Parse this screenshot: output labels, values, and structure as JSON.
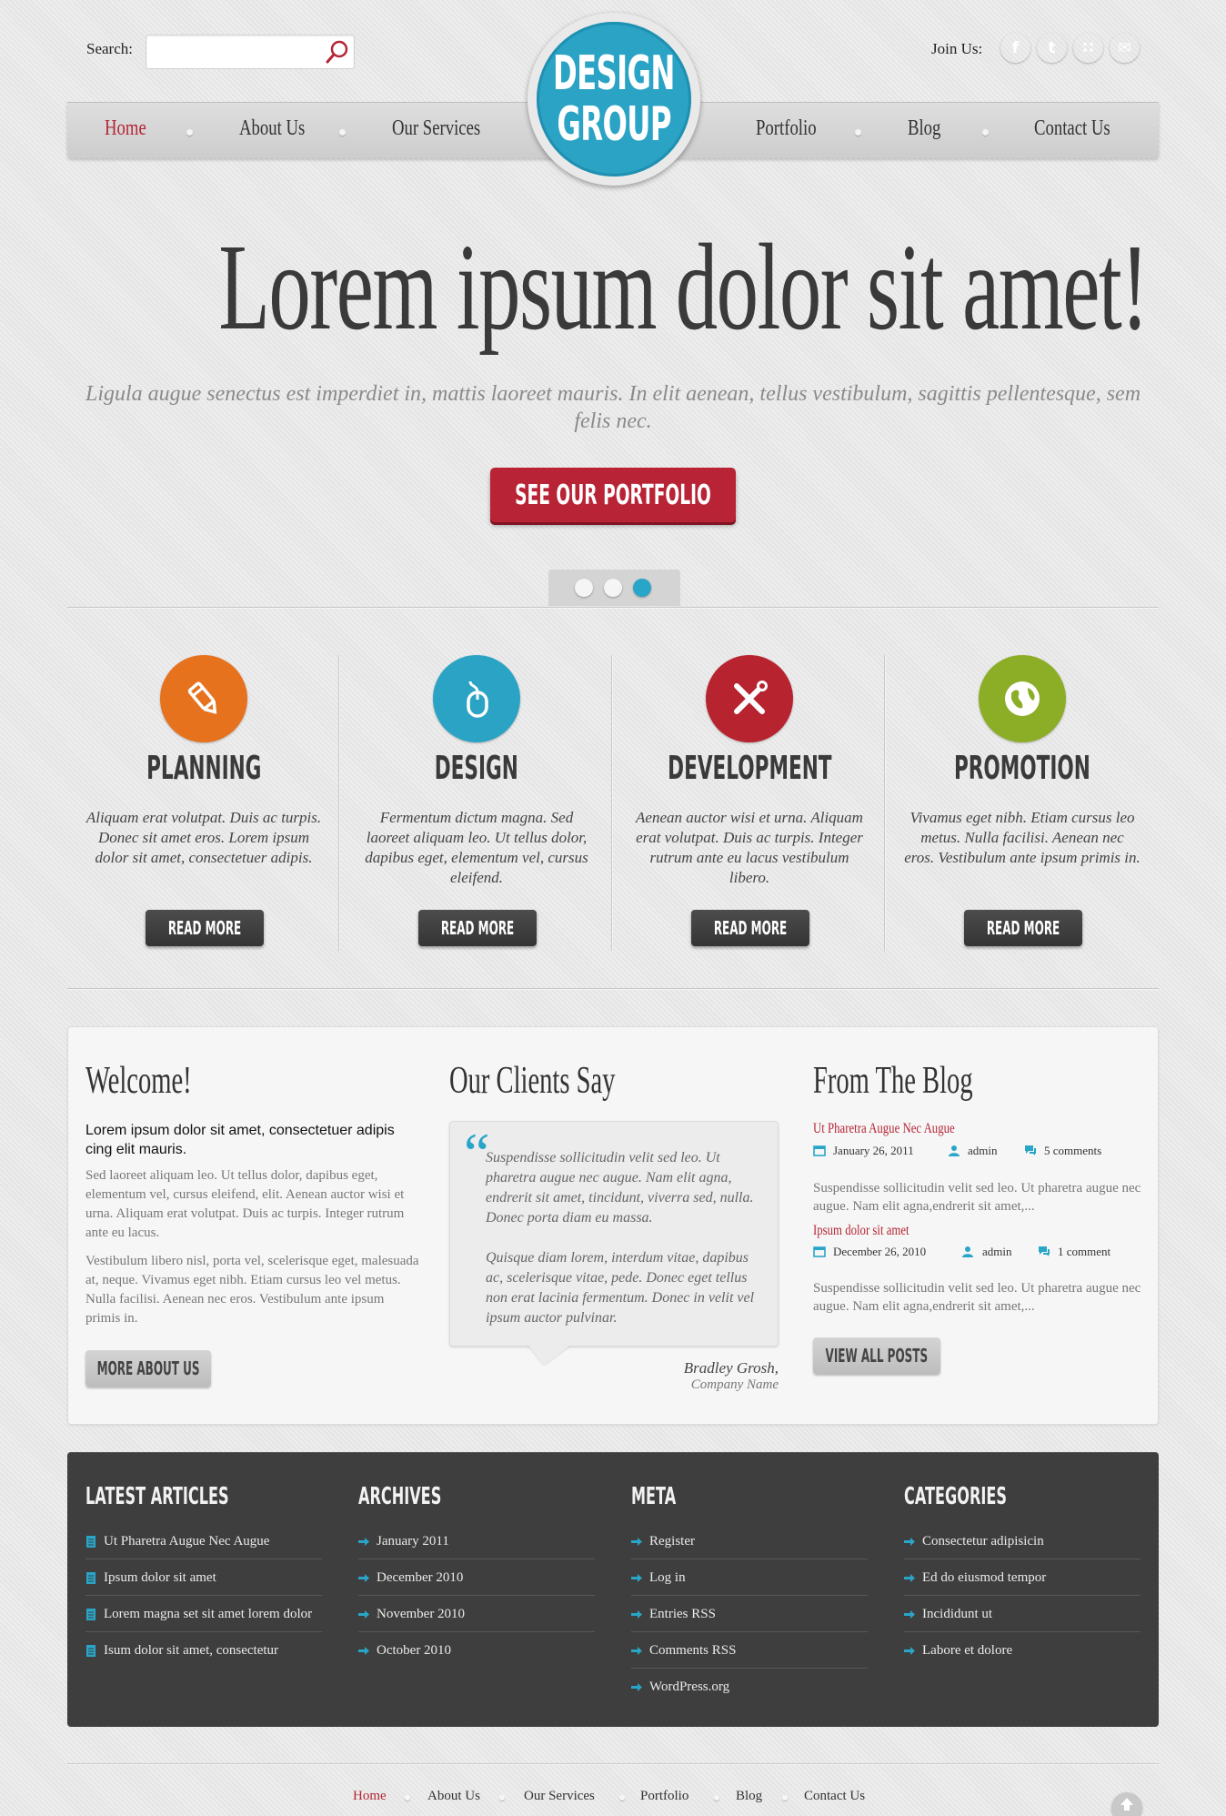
{
  "header": {
    "search_label": "Search:",
    "search_placeholder": "",
    "join_label": "Join Us:",
    "social": [
      {
        "name": "facebook",
        "glyph": "f",
        "color": "#3a5a98"
      },
      {
        "name": "twitter",
        "glyph": "t",
        "color": "#2aa4dd"
      },
      {
        "name": "rss",
        "glyph": "∷",
        "color": "#f1951f"
      },
      {
        "name": "email",
        "glyph": "✉",
        "color": "#a7a7a7"
      }
    ],
    "logo": {
      "line1": "DESIGN",
      "line2": "GROUP"
    }
  },
  "nav": {
    "items": [
      "Home",
      "About Us",
      "Our Services",
      "Portfolio",
      "Blog",
      "Contact Us"
    ],
    "active": "Home"
  },
  "hero": {
    "title": "Lorem ipsum dolor sit amet!",
    "subtitle": "Ligula augue senectus est imperdiet in, mattis laoreet mauris. In elit aenean, tellus vestibulum, sagittis pellentesque, sem felis nec.",
    "cta_label": "SEE OUR PORTFOLIO",
    "slides_total": 3,
    "slide_active": 3
  },
  "features": [
    {
      "title": "PLANNING",
      "icon": "pencil-icon",
      "color": "#e6721d",
      "text": "Aliquam erat volutpat. Duis ac turpis. Donec sit amet eros. Lorem ipsum dolor sit amet, consectetuer adipis.",
      "button": "READ MORE"
    },
    {
      "title": "DESIGN",
      "icon": "mouse-icon",
      "color": "#2ba3c5",
      "text": "Fermentum dictum magna. Sed laoreet aliquam leo. Ut tellus dolor, dapibus eget, elementum vel, cursus eleifend.",
      "button": "READ MORE"
    },
    {
      "title": "DEVELOPMENT",
      "icon": "tools-icon",
      "color": "#b7232f",
      "text": "Aenean auctor wisi et urna. Aliquam erat volutpat. Duis ac turpis. Integer rutrum ante eu lacus vestibulum libero.",
      "button": "READ MORE"
    },
    {
      "title": "PROMOTION",
      "icon": "globe-icon",
      "color": "#8cae26",
      "text": "Vivamus eget nibh. Etiam cursus leo metus. Nulla facilisi. Aenean nec eros. Vestibulum ante ipsum primis in.",
      "button": "READ MORE"
    }
  ],
  "welcome": {
    "title": "Welcome!",
    "lead": "Lorem ipsum dolor sit amet, consectetuer adipis cing elit mauris.",
    "p1": "Sed laoreet aliquam leo. Ut tellus dolor, dapibus eget, elementum vel, cursus eleifend, elit. Aenean auctor wisi et urna. Aliquam erat volutpat. Duis ac turpis. Integer rutrum ante eu lacus.",
    "p2": "Vestibulum libero nisl, porta vel, scelerisque eget, malesuada at, neque. Vivamus eget nibh. Etiam cursus leo vel metus. Nulla facilisi. Aenean nec eros. Vestibulum ante ipsum primis in.",
    "button": "MORE ABOUT US"
  },
  "testimonial": {
    "title": "Our Clients Say",
    "p1": "Suspendisse sollicitudin velit sed leo. Ut pharetra augue nec augue. Nam elit agna, endrerit sit amet, tincidunt, viverra sed, nulla. Donec porta diam eu massa.",
    "p2": "Quisque diam lorem, interdum vitae, dapibus ac, scelerisque vitae, pede. Donec eget tellus non erat lacinia fermentum. Donec in velit vel ipsum auctor pulvinar.",
    "author": "Bradley Grosh,",
    "company": "Company Name"
  },
  "blog": {
    "title": "From The Blog",
    "posts": [
      {
        "title": "Ut Pharetra Augue Nec Augue",
        "date": "January 26, 2011",
        "author": "admin",
        "comments": "5 comments",
        "excerpt": "Suspendisse sollicitudin velit sed leo. Ut pharetra augue nec augue. Nam elit agna,endrerit sit amet,..."
      },
      {
        "title": "Ipsum dolor sit amet",
        "date": "December 26, 2010",
        "author": "admin",
        "comments": "1 comment",
        "excerpt": "Suspendisse sollicitudin velit sed leo. Ut pharetra augue nec augue. Nam elit agna,endrerit sit amet,..."
      }
    ],
    "button": "VIEW ALL POSTS"
  },
  "widgets": {
    "latest": {
      "title": "LATEST ARTICLES",
      "items": [
        "Ut Pharetra Augue Nec Augue",
        "Ipsum dolor sit amet",
        "Lorem magna set sit amet lorem dolor",
        "Isum dolor sit amet, consectetur"
      ]
    },
    "archives": {
      "title": "ARCHIVES",
      "items": [
        "January 2011",
        "December 2010",
        "November 2010",
        "October 2010"
      ]
    },
    "meta": {
      "title": "META",
      "items": [
        "Register",
        "Log in",
        "Entries RSS",
        "Comments RSS",
        "WordPress.org"
      ]
    },
    "categories": {
      "title": "CATEGORIES",
      "items": [
        "Consectetur adipisicin",
        "Ed do eiusmod tempor",
        "Incididunt ut",
        "Labore et dolore"
      ]
    }
  },
  "footer": {
    "items": [
      "Home",
      "About Us",
      "Our Services",
      "Portfolio",
      "Blog",
      "Contact Us"
    ],
    "active": "Home"
  }
}
